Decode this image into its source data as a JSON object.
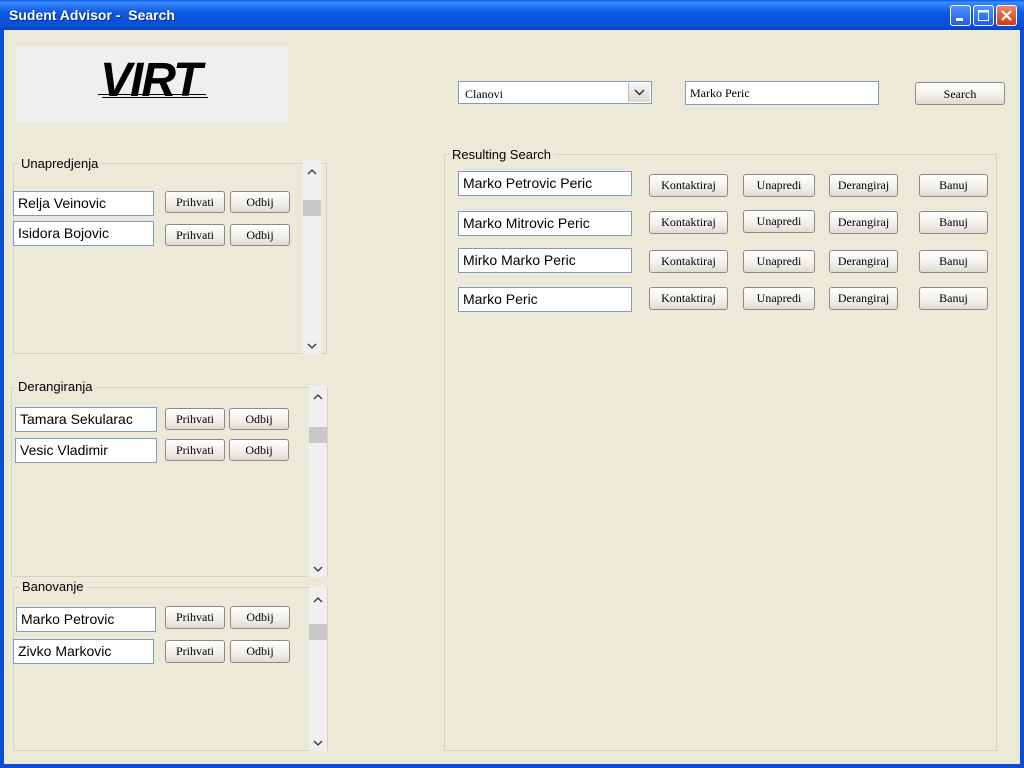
{
  "window": {
    "title": "Sudent Advisor -  Search",
    "controls": [
      "minimize-icon",
      "maximize-icon",
      "close-icon"
    ],
    "title_bar_color": "#0b4ed6"
  },
  "logo": {
    "text": "VIRT"
  },
  "search": {
    "category_selected": "Clanovi",
    "query": "Marko Peric",
    "button_label": "Search"
  },
  "results": {
    "title": "Resulting Search",
    "rows": [
      {
        "name": "Marko Petrovic Peric",
        "contact": "Kontaktiraj",
        "promote": "Unapredi",
        "demote": "Derangiraj",
        "ban": "Banuj"
      },
      {
        "name": "Marko Mitrovic Peric",
        "contact": "Kontaktiraj",
        "promote": "Unapredi",
        "demote": "Derangiraj",
        "ban": "Banuj"
      },
      {
        "name": "Mirko Marko Peric",
        "contact": "Kontaktiraj",
        "promote": "Unapredi",
        "demote": "Derangiraj",
        "ban": "Banuj"
      },
      {
        "name": "Marko Peric",
        "contact": "Kontaktiraj",
        "promote": "Unapredi",
        "demote": "Derangiraj",
        "ban": "Banuj"
      }
    ]
  },
  "panels": [
    {
      "title": "Unapredjenja",
      "items": [
        {
          "name": "Relja Veinovic",
          "accept": "Prihvati",
          "reject": "Odbij"
        },
        {
          "name": "Isidora Bojovic",
          "accept": "Prihvati",
          "reject": "Odbij"
        }
      ]
    },
    {
      "title": "Derangiranja",
      "items": [
        {
          "name": "Tamara Sekularac",
          "accept": "Prihvati",
          "reject": "Odbij"
        },
        {
          "name": "Vesic Vladimir",
          "accept": "Prihvati",
          "reject": "Odbij"
        }
      ]
    },
    {
      "title": "Banovanje",
      "items": [
        {
          "name": "Marko Petrovic",
          "accept": "Prihvati",
          "reject": "Odbij"
        },
        {
          "name": "Zivko Markovic",
          "accept": "Prihvati",
          "reject": "Odbij"
        }
      ]
    }
  ],
  "colors": {
    "client_background": "#ece9d8",
    "field_border": "#7f9db9"
  }
}
